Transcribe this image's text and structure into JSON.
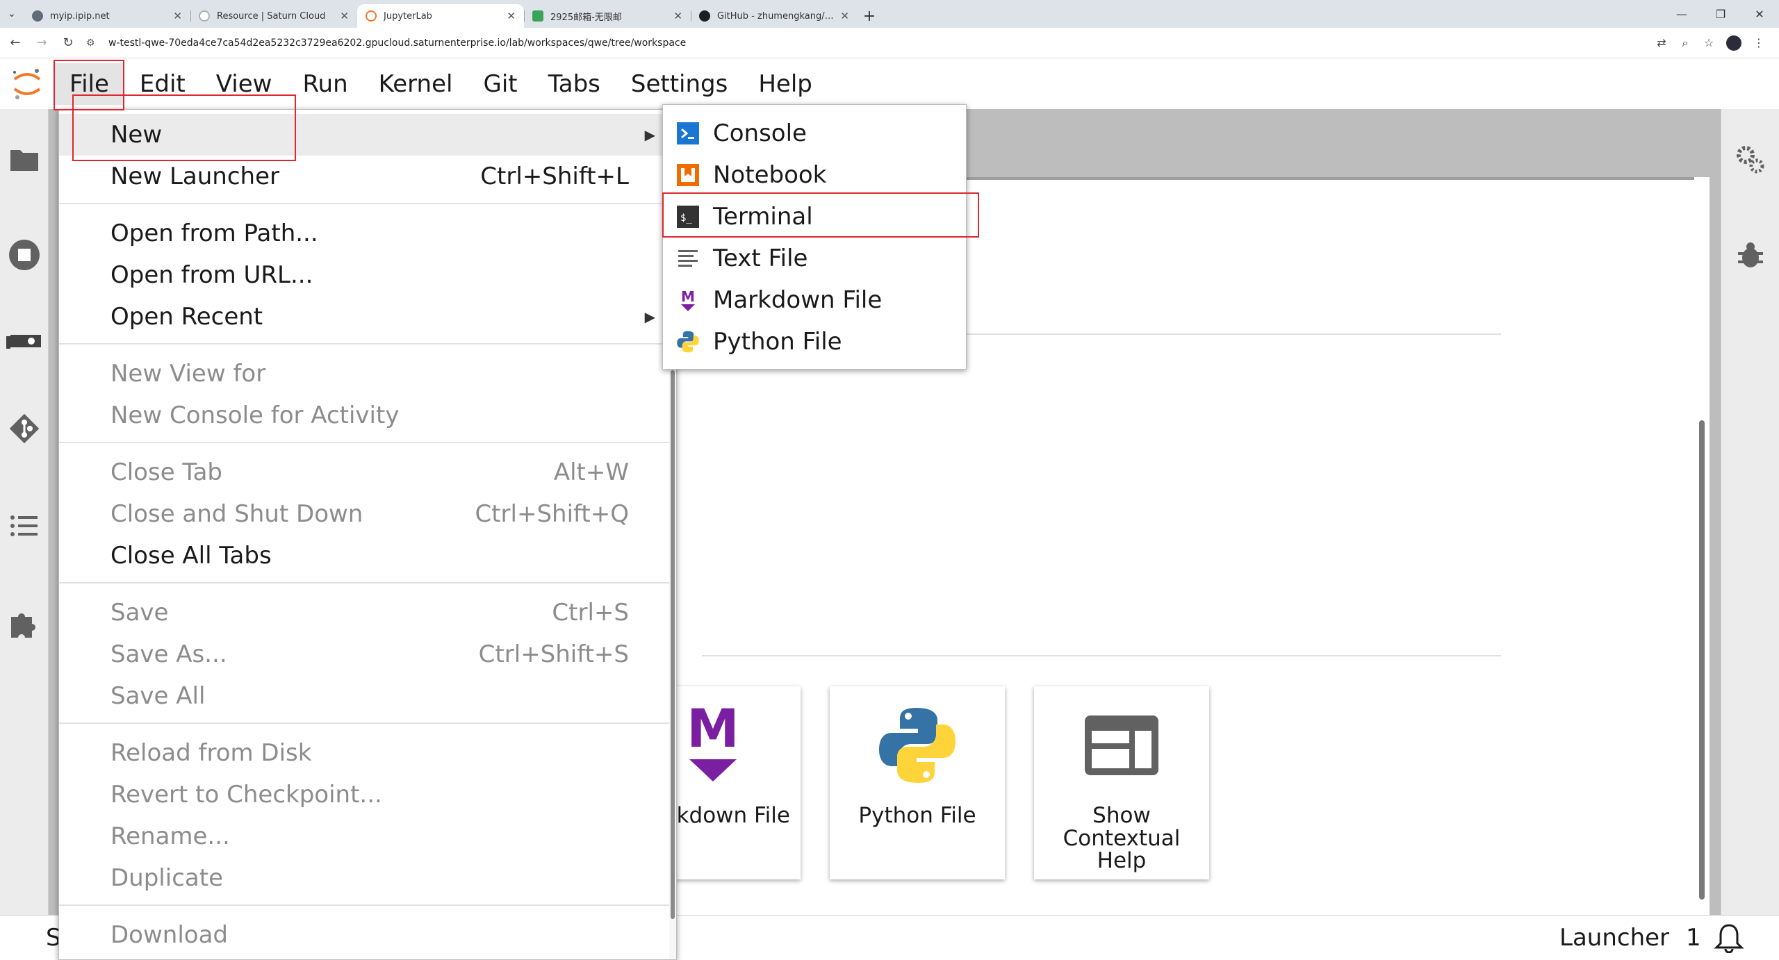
{
  "browser": {
    "tabs": [
      {
        "title": "myip.ipip.net",
        "active": false
      },
      {
        "title": "Resource | Saturn Cloud",
        "active": false
      },
      {
        "title": "JupyterLab",
        "active": true
      },
      {
        "title": "2925邮箱-无限邮",
        "active": false
      },
      {
        "title": "GitHub - zhumengkang/agsb",
        "active": false
      }
    ],
    "url": "w-testl-qwe-70eda4ce7ca54d2ea5232c3729ea6202.gpucloud.saturnenterprise.io/lab/workspaces/qwe/tree/workspace"
  },
  "menubar": {
    "items": [
      "File",
      "Edit",
      "View",
      "Run",
      "Kernel",
      "Git",
      "Tabs",
      "Settings",
      "Help"
    ]
  },
  "file_menu": {
    "items": [
      {
        "label": "New",
        "shortcut": "",
        "submenu": true,
        "disabled": false
      },
      {
        "label": "New Launcher",
        "shortcut": "Ctrl+Shift+L",
        "submenu": false,
        "disabled": false
      },
      {
        "label": "Open from Path...",
        "shortcut": "",
        "submenu": false,
        "disabled": false
      },
      {
        "label": "Open from URL...",
        "shortcut": "",
        "submenu": false,
        "disabled": false
      },
      {
        "label": "Open Recent",
        "shortcut": "",
        "submenu": true,
        "disabled": false
      },
      {
        "label": "New View for",
        "shortcut": "",
        "submenu": false,
        "disabled": true
      },
      {
        "label": "New Console for Activity",
        "shortcut": "",
        "submenu": false,
        "disabled": true
      },
      {
        "label": "Close Tab",
        "shortcut": "Alt+W",
        "submenu": false,
        "disabled": true
      },
      {
        "label": "Close and Shut Down",
        "shortcut": "Ctrl+Shift+Q",
        "submenu": false,
        "disabled": true
      },
      {
        "label": "Close All Tabs",
        "shortcut": "",
        "submenu": false,
        "disabled": false
      },
      {
        "label": "Save",
        "shortcut": "Ctrl+S",
        "submenu": false,
        "disabled": true
      },
      {
        "label": "Save As...",
        "shortcut": "Ctrl+Shift+S",
        "submenu": false,
        "disabled": true
      },
      {
        "label": "Save All",
        "shortcut": "",
        "submenu": false,
        "disabled": true
      },
      {
        "label": "Reload from Disk",
        "shortcut": "",
        "submenu": false,
        "disabled": true
      },
      {
        "label": "Revert to Checkpoint...",
        "shortcut": "",
        "submenu": false,
        "disabled": true
      },
      {
        "label": "Rename...",
        "shortcut": "",
        "submenu": false,
        "disabled": true
      },
      {
        "label": "Duplicate",
        "shortcut": "",
        "submenu": false,
        "disabled": true
      },
      {
        "label": "Download",
        "shortcut": "",
        "submenu": false,
        "disabled": true
      }
    ]
  },
  "new_submenu": {
    "items": [
      {
        "label": "Console",
        "icon": "console-icon"
      },
      {
        "label": "Notebook",
        "icon": "notebook-icon"
      },
      {
        "label": "Terminal",
        "icon": "terminal-icon"
      },
      {
        "label": "Text File",
        "icon": "text-file-icon"
      },
      {
        "label": "Markdown File",
        "icon": "markdown-icon"
      },
      {
        "label": "Python File",
        "icon": "python-icon"
      }
    ]
  },
  "launcher": {
    "cards": [
      {
        "label": "Markdown File",
        "icon": "markdown-icon"
      },
      {
        "label": "Python File",
        "icon": "python-icon"
      },
      {
        "label": "Show Contextual Help",
        "icon": "contextual-help-icon"
      }
    ]
  },
  "statusbar": {
    "left_text": "S",
    "launcher_label": "Launcher",
    "notification_count": "1"
  },
  "colors": {
    "highlight": "#e0262f",
    "jupyter_orange": "#f37726",
    "markdown_purple": "#7b1fa2",
    "python_blue": "#3572a5",
    "python_yellow": "#ffd43b"
  }
}
